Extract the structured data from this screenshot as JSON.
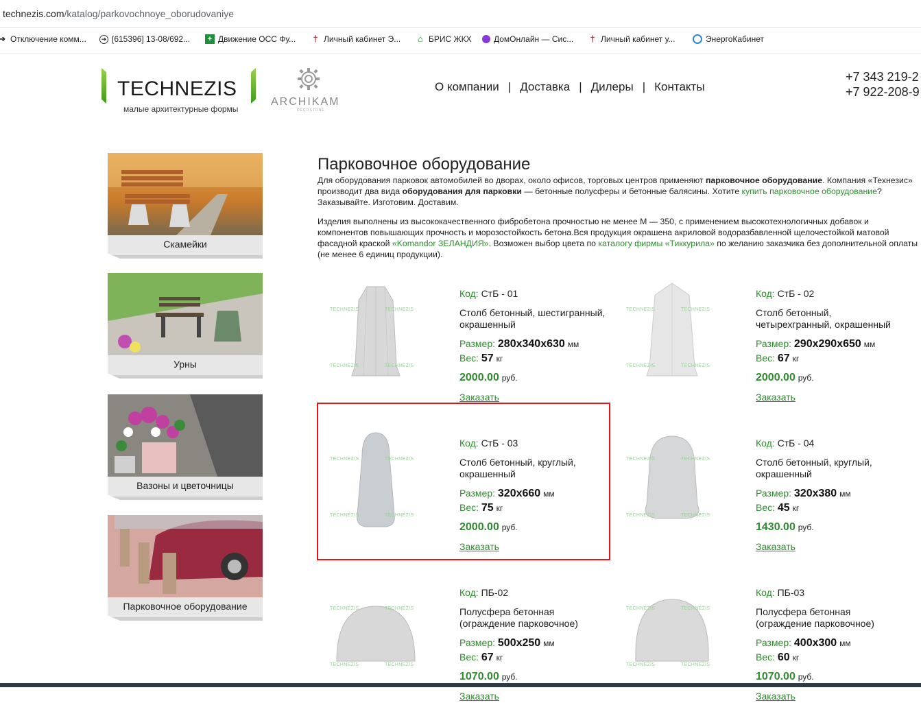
{
  "browser": {
    "url_host": "technezis.com",
    "url_path": "/katalog/parkovochnoye_oborudovaniye",
    "bookmarks": [
      {
        "icon": "arrow-circle-icon",
        "label": "Отключение комм..."
      },
      {
        "icon": "arrow-circle-icon",
        "label": "[615396] 13-08/692..."
      },
      {
        "icon": "green-plus-icon",
        "label": "Движение ОСС Фу..."
      },
      {
        "icon": "cross-t-icon",
        "label": "Личный кабинет Э..."
      },
      {
        "icon": "house-icon",
        "label": "БРИС ЖКХ"
      },
      {
        "icon": "purple-circle-icon",
        "label": "ДомОнлайн — Сис..."
      },
      {
        "icon": "cross-t-icon",
        "label": "Личный кабинет у..."
      },
      {
        "icon": "blue-swirl-icon",
        "label": "ЭнергоКабинет"
      }
    ]
  },
  "header": {
    "logo_name": "TECHNEZIS",
    "logo_sub": "малые архитектурные формы",
    "partner_name": "ARCHIKAM",
    "partner_tag": "DECOSTONE",
    "nav": [
      "О компании",
      "Доставка",
      "Дилеры",
      "Контакты"
    ],
    "phones": [
      "+7 343 219-2",
      "+7 922-208-9"
    ]
  },
  "sidebar": {
    "categories": [
      {
        "label": "Скамейки",
        "icon": "bench-image"
      },
      {
        "label": "Урны",
        "icon": "urn-image"
      },
      {
        "label": "Вазоны и цветочницы",
        "icon": "flowerpot-image"
      },
      {
        "label": "Парковочное оборудование",
        "icon": "parking-image"
      }
    ]
  },
  "main": {
    "title": "Парковочное оборудование",
    "intro1_a": "Для оборудования парковок автомобилей во дворах, около офисов, торговых центров применяют ",
    "intro1_b": "парковочное оборудование",
    "intro1_c": ". Компания «Технезис» производит два вида ",
    "intro1_d": "оборудования для парковки",
    "intro1_e": " — бетонные полусферы и бетонные балясины. Хотите ",
    "intro1_link": "купить парковочное оборудование",
    "intro1_f": "? Заказывайте. Изготовим. Доставим.",
    "intro2_a": "Изделия выполнены из высококачественного фибробетона прочностью не менее М — 350, с применением высокотехнологичных добавок и компонентов повышающих прочность и морозостойкость бетона.Вся продукция окрашена акриловой водоразбавленной щелочестойкой матовой фасадной краской ",
    "intro2_link1": "«Komandor ЗЕЛАНДИЯ»",
    "intro2_b": ". Возможен выбор цвета по ",
    "intro2_link2": "каталогу фирмы «Тиккурила»",
    "intro2_c": " по желанию заказчика без дополнительной оплаты (не менее 6 единиц продукции)."
  },
  "labels": {
    "code": "Код:",
    "size": "Размер:",
    "weight": "Вес:",
    "mm": "мм",
    "kg": "кг",
    "rub": "руб.",
    "order": "Заказать",
    "watermark": "TECHNEZIS"
  },
  "products": [
    {
      "code": "СтБ - 01",
      "desc": "Столб бетонный, шестигранный, окрашенный",
      "size": "280x340x630",
      "weight": "57",
      "price": "2000.00",
      "shape": "hex-post"
    },
    {
      "code": "СтБ - 02",
      "desc": "Столб бетонный, четырехгранный, окрашенный",
      "size": "290x290x650",
      "weight": "67",
      "price": "2000.00",
      "shape": "square-post"
    },
    {
      "code": "СтБ - 03",
      "desc": "Столб бетонный, круглый, окрашенный",
      "size": "320x660",
      "weight": "75",
      "price": "2000.00",
      "shape": "round-tall"
    },
    {
      "code": "СтБ - 04",
      "desc": "Столб бетонный, круглый, окрашенный",
      "size": "320x380",
      "weight": "45",
      "price": "1430.00",
      "shape": "round-short"
    },
    {
      "code": "ПБ-02",
      "desc": "Полусфера бетонная (ограждение парковочное)",
      "size": "500x250",
      "weight": "67",
      "price": "1070.00",
      "shape": "hemisphere"
    },
    {
      "code": "ПБ-03",
      "desc": "Полусфера бетонная (ограждение парковочное)",
      "size": "400x300",
      "weight": "60",
      "price": "1070.00",
      "shape": "hemisphere-tall"
    }
  ],
  "colors": {
    "accent_green": "#2e8b2e",
    "highlight_red": "#e11"
  }
}
